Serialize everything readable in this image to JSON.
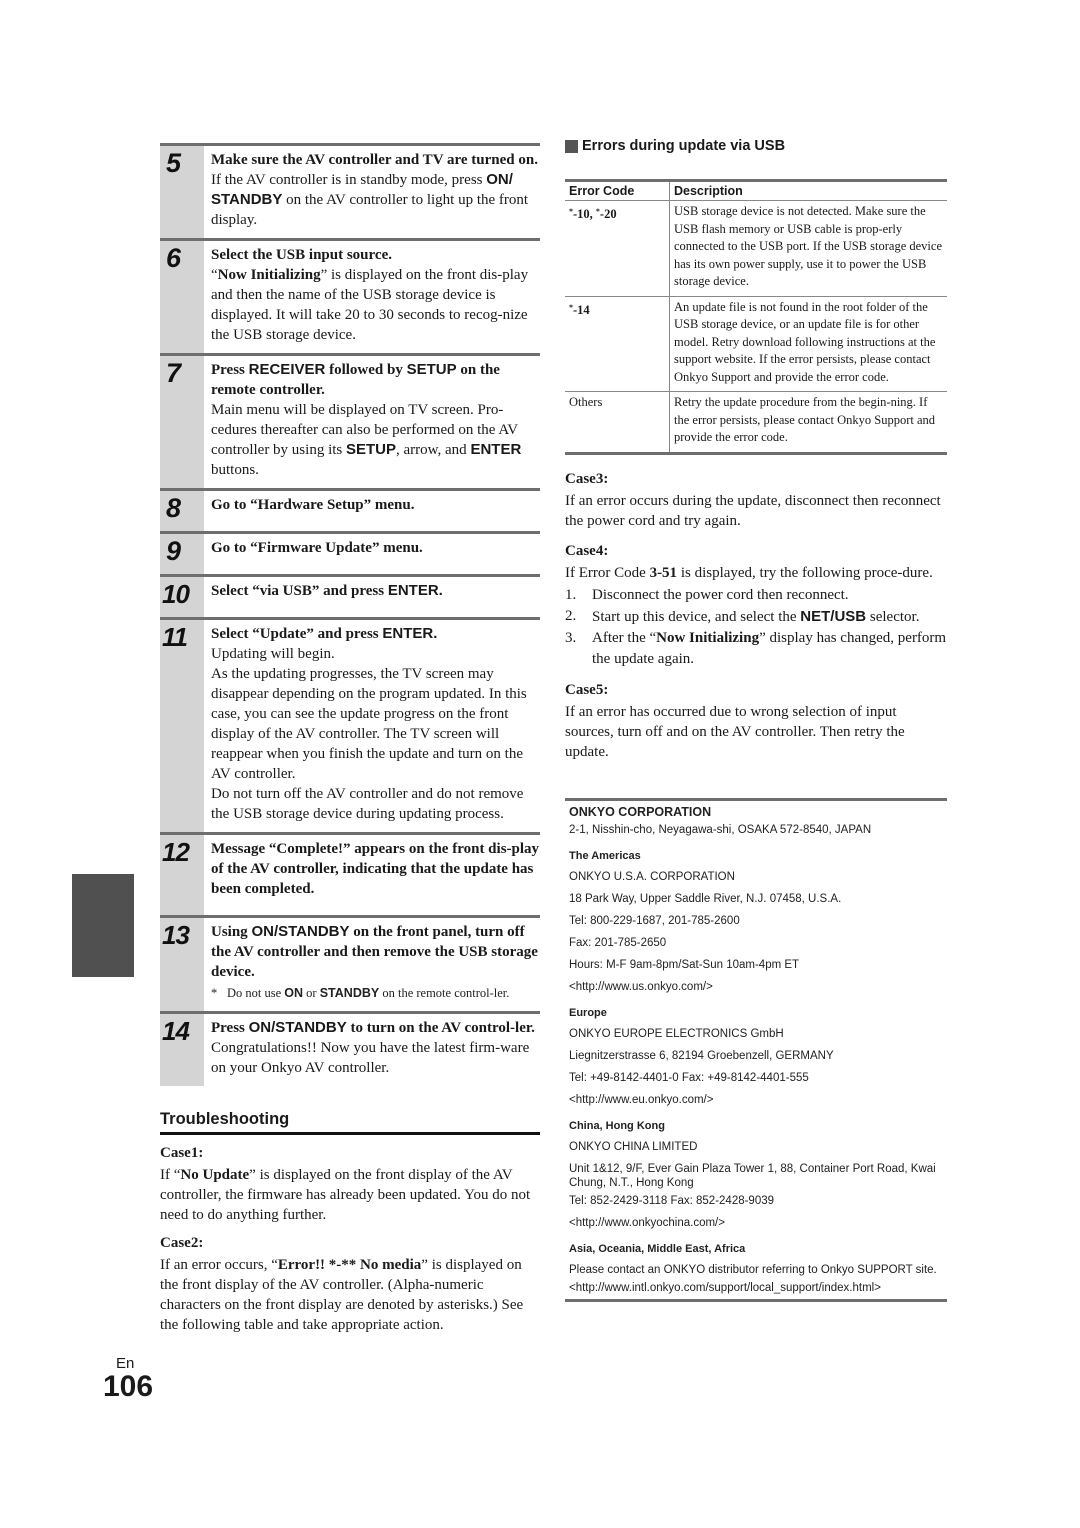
{
  "steps": [
    {
      "num": "5",
      "title": "Make sure the AV controller and TV are turned on.",
      "body": [
        [
          {
            "t": "If the AV controller is in standby mode, press "
          },
          {
            "t": "ON/ STANDBY",
            "s": "sb"
          },
          {
            "t": " on the AV controller to light up the front display."
          }
        ]
      ]
    },
    {
      "num": "6",
      "title": "Select the USB input source.",
      "body": [
        [
          {
            "t": "“"
          },
          {
            "t": "Now Initializing",
            "s": "b"
          },
          {
            "t": "” is displayed on the front dis-play and then the name of the USB storage device is displayed. It will take 20 to 30 seconds to recog-nize the USB storage device."
          }
        ]
      ]
    },
    {
      "num": "7",
      "title_parts": [
        {
          "t": "Press "
        },
        {
          "t": "RECEIVER",
          "s": "sb"
        },
        {
          "t": " followed by "
        },
        {
          "t": "SETUP",
          "s": "sb"
        },
        {
          "t": " on the remote controller."
        }
      ],
      "body": [
        [
          {
            "t": "Main menu will be displayed on TV screen. Pro-cedures thereafter can also be performed on the AV controller by using its "
          },
          {
            "t": "SETUP",
            "s": "sb"
          },
          {
            "t": ", arrow, and "
          },
          {
            "t": "ENTER",
            "s": "sb"
          },
          {
            "t": " buttons."
          }
        ]
      ]
    },
    {
      "num": "8",
      "title": "Go to “Hardware Setup” menu.",
      "body": []
    },
    {
      "num": "9",
      "title": "Go to “Firmware Update” menu.",
      "body": []
    },
    {
      "num": "10",
      "title_parts": [
        {
          "t": "Select “via USB” and press "
        },
        {
          "t": "ENTER.",
          "s": "sb"
        }
      ],
      "body": []
    },
    {
      "num": "11",
      "title_parts": [
        {
          "t": "Select “Update” and press "
        },
        {
          "t": "ENTER.",
          "s": "sb"
        }
      ],
      "body": [
        [
          {
            "t": "Updating will begin."
          }
        ],
        [
          {
            "t": "As the updating progresses, the TV screen may disappear depending on the program updated. In this case, you can see the update progress on the front display of the AV controller. The TV screen will reappear when you finish the update and turn on the AV controller."
          }
        ],
        [
          {
            "t": "Do not turn off the AV controller and do not remove the USB storage device during updating process."
          }
        ]
      ]
    },
    {
      "num": "12",
      "title": "Message “Complete!” appears on the front dis-play of the AV controller, indicating that the update has been completed.",
      "body": []
    },
    {
      "num": "13",
      "title_parts": [
        {
          "t": "Using "
        },
        {
          "t": "ON/STANDBY",
          "s": "sb"
        },
        {
          "t": " on the front panel, turn off the AV controller and then remove the USB storage device."
        }
      ],
      "note": [
        {
          "t": "Do not use "
        },
        {
          "t": "ON",
          "s": "sb"
        },
        {
          "t": " or "
        },
        {
          "t": "STANDBY",
          "s": "sb"
        },
        {
          "t": " on the remote control-ler."
        }
      ],
      "body": []
    },
    {
      "num": "14",
      "title_parts": [
        {
          "t": "Press "
        },
        {
          "t": "ON/STANDBY",
          "s": "sb"
        },
        {
          "t": " to turn on the AV control-ler."
        }
      ],
      "body": [
        [
          {
            "t": "Congratulations!! Now you have the latest firm-ware on your Onkyo AV controller."
          }
        ]
      ]
    }
  ],
  "note_marker": "*",
  "troubleshooting": {
    "heading": "Troubleshooting",
    "case1": {
      "label": "Case1:",
      "text": [
        {
          "t": "If “"
        },
        {
          "t": "No Update",
          "s": "b"
        },
        {
          "t": "” is displayed on the front display of the AV controller, the firmware has already been updated. You do not need to do anything further."
        }
      ]
    },
    "case2": {
      "label": "Case2:",
      "text": [
        {
          "t": "If an error occurs, “"
        },
        {
          "t": "Error!! *-** No media",
          "s": "b"
        },
        {
          "t": "” is displayed on the front display of the AV controller. (Alpha-numeric characters on the front display are denoted by asterisks.) See the following table and take appropriate action."
        }
      ]
    }
  },
  "errors_section": {
    "heading": "Errors during update via USB",
    "columns": [
      "Error Code",
      "Description"
    ],
    "rows": [
      {
        "code": "*-10, *-20",
        "bold": true,
        "description": "USB storage device is not detected. Make sure the USB flash memory or USB cable is prop-erly connected to the USB port. If the USB storage device has its own power supply, use it to power the USB storage device."
      },
      {
        "code": "*-14",
        "bold": true,
        "description": "An update file is not found in the root folder of the USB storage device, or an update file is for other model. Retry download following instructions at the support website. If the error persists, please contact Onkyo Support and provide the error code."
      },
      {
        "code": "Others",
        "bold": false,
        "description": "Retry the update procedure from the begin-ning. If the error persists, please contact Onkyo Support and provide the error code."
      }
    ]
  },
  "case3": {
    "label": "Case3:",
    "text": "If an error occurs during the update, disconnect then reconnect the power cord and try again."
  },
  "case4": {
    "label": "Case4:",
    "text": [
      {
        "t": "If Error Code "
      },
      {
        "t": "3-51",
        "s": "b"
      },
      {
        "t": " is displayed, try the following proce-dure."
      }
    ],
    "steps": [
      {
        "n": "1.",
        "parts": [
          {
            "t": "Disconnect the power cord then reconnect."
          }
        ]
      },
      {
        "n": "2.",
        "parts": [
          {
            "t": "Start up this device, and select the "
          },
          {
            "t": "NET/USB",
            "s": "sb"
          },
          {
            "t": " selector."
          }
        ]
      },
      {
        "n": "3.",
        "parts": [
          {
            "t": "After the “"
          },
          {
            "t": "Now Initializing",
            "s": "b"
          },
          {
            "t": "” display has changed, perform the update again."
          }
        ]
      }
    ]
  },
  "case5": {
    "label": "Case5:",
    "text": "If an error has occurred due to wrong selection of input sources, turn off and on the AV controller. Then retry the update."
  },
  "contacts": {
    "corp": "ONKYO CORPORATION",
    "corp_address": "2-1, Nisshin-cho, Neyagawa-shi, OSAKA 572-8540, JAPAN",
    "americas": {
      "region": "The Americas",
      "lines": [
        "ONKYO U.S.A. CORPORATION",
        "18 Park Way, Upper Saddle River, N.J. 07458, U.S.A.",
        "Tel: 800-229-1687, 201-785-2600",
        "Fax: 201-785-2650",
        "Hours: M-F 9am-8pm/Sat-Sun 10am-4pm ET",
        "<http://www.us.onkyo.com/>"
      ]
    },
    "europe": {
      "region": "Europe",
      "lines": [
        "ONKYO EUROPE ELECTRONICS GmbH",
        "Liegnitzerstrasse 6, 82194 Groebenzell, GERMANY",
        "Tel: +49-8142-4401-0 Fax: +49-8142-4401-555",
        "<http://www.eu.onkyo.com/>"
      ]
    },
    "china": {
      "region": "China, Hong Kong",
      "name": "ONKYO CHINA LIMITED",
      "address": "Unit 1&12, 9/F, Ever Gain Plaza Tower 1, 88, Container Port Road, Kwai Chung, N.T., Hong Kong",
      "tel": "Tel: 852-2429-3118 Fax: 852-2428-9039",
      "url": "<http://www.onkyochina.com/>"
    },
    "asia": {
      "region": "Asia, Oceania, Middle East, Africa",
      "text": "Please contact an ONKYO distributor referring to Onkyo SUPPORT site.",
      "url": "<http://www.intl.onkyo.com/support/local_support/index.html>"
    }
  },
  "footer": {
    "lang": "En",
    "page": "106"
  }
}
